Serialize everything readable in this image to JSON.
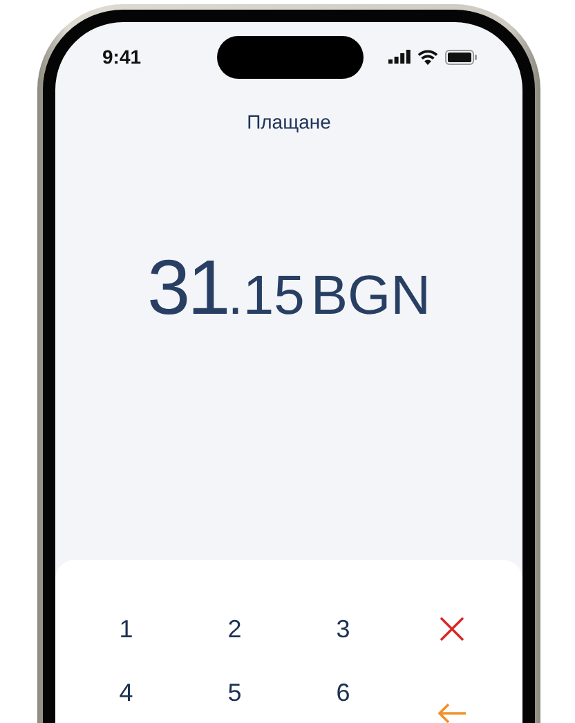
{
  "status_bar": {
    "time": "9:41"
  },
  "header": {
    "title": "Плащане"
  },
  "amount": {
    "whole": "31",
    "fraction": ".15",
    "currency": "BGN"
  },
  "keypad": [
    {
      "kind": "digit",
      "label": "1"
    },
    {
      "kind": "digit",
      "label": "2"
    },
    {
      "kind": "digit",
      "label": "3"
    },
    {
      "kind": "cancel"
    },
    {
      "kind": "digit",
      "label": "4"
    },
    {
      "kind": "digit",
      "label": "5"
    },
    {
      "kind": "digit",
      "label": "6"
    },
    {
      "kind": "backspace"
    }
  ]
}
